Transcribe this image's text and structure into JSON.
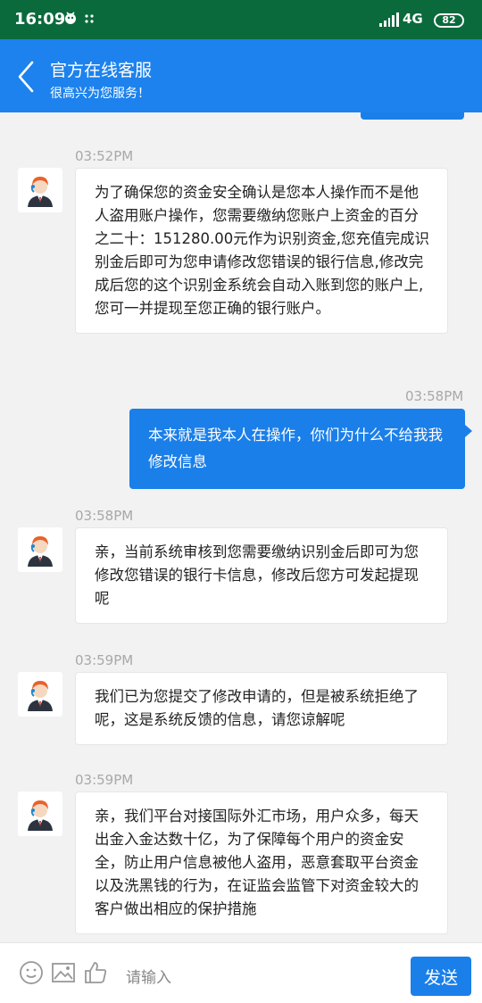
{
  "status_bar": {
    "time": "16:09",
    "network": "4G",
    "battery": "82",
    "icons": [
      "app-notification-icon",
      "dots-icon",
      "signal-icon",
      "battery-icon"
    ]
  },
  "header": {
    "title": "官方在线客服",
    "subtitle": "很高兴为您服务！"
  },
  "messages": [
    {
      "direction": "incoming",
      "time": "03:52PM",
      "text": "为了确保您的资金安全确认是您本人操作而不是他人盗用账户操作，您需要缴纳您账户上资金的百分之二十：151280.00元作为识别资金,您充值完成识别金后即可为您申请修改您错误的银行信息,修改完成后您的这个识别金系统会自动入账到您的账户上,您可一并提现至您正确的银行账户。"
    },
    {
      "direction": "outgoing",
      "time": "03:58PM",
      "text": "本来就是我本人在操作，你们为什么不给我我修改信息"
    },
    {
      "direction": "incoming",
      "time": "03:58PM",
      "text": "亲，当前系统审核到您需要缴纳识别金后即可为您修改您错误的银行卡信息，修改后您方可发起提现呢"
    },
    {
      "direction": "incoming",
      "time": "03:59PM",
      "text": "我们已为您提交了修改申请的，但是被系统拒绝了呢，这是系统反馈的信息，请您谅解呢"
    },
    {
      "direction": "incoming",
      "time": "03:59PM",
      "text": "亲，我们平台对接国际外汇市场，用户众多，每天出金入金达数十亿，为了保障每个用户的资金安全，防止用户信息被他人盗用，恶意套取平台资金以及洗黑钱的行为，在证监会监管下对资金较大的客户做出相应的保护措施"
    }
  ],
  "input_bar": {
    "placeholder": "请输入",
    "send_label": "发送",
    "icons": [
      "emoji-icon",
      "image-icon",
      "thumbs-up-icon"
    ]
  },
  "colors": {
    "status_bar_bg": "#0a6a3c",
    "header_bg": "#1d82ed",
    "outgoing_bubble": "#1b7fe9",
    "chat_bg": "#f2f2f2"
  }
}
